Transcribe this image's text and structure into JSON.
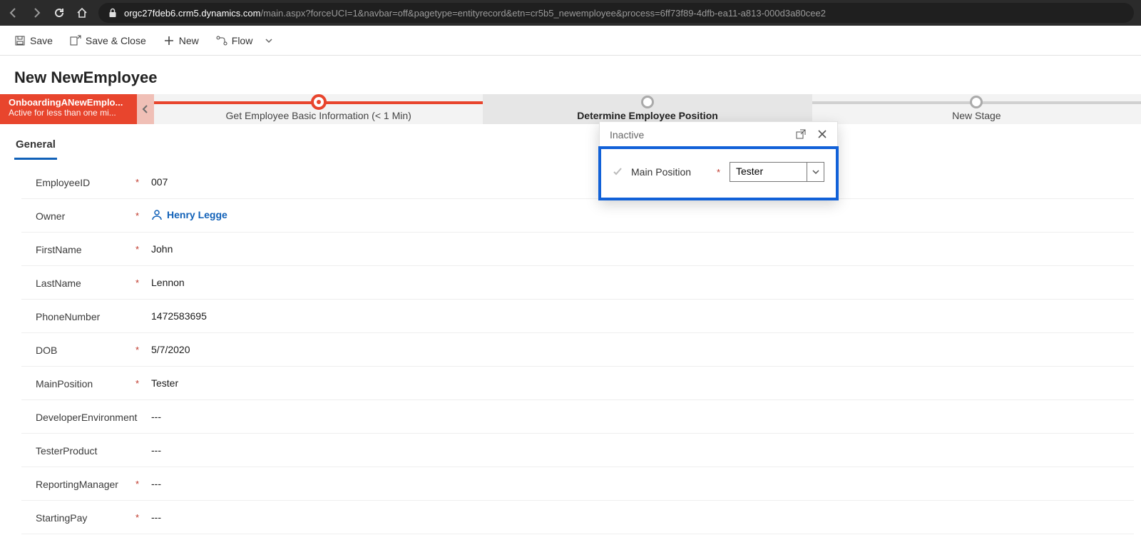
{
  "browser": {
    "url_domain": "orgc27fdeb6.crm5.dynamics.com",
    "url_path": "/main.aspx?forceUCI=1&navbar=off&pagetype=entityrecord&etn=cr5b5_newemployee&process=6ff73f89-4dfb-ea11-a813-000d3a80cee2"
  },
  "cmdbar": {
    "save": "Save",
    "save_close": "Save & Close",
    "new": "New",
    "flow": "Flow"
  },
  "page": {
    "title": "New NewEmployee"
  },
  "bpf": {
    "name": "OnboardingANewEmplo...",
    "status": "Active for less than one mi...",
    "stages": [
      {
        "label": "Get Employee Basic Information  (< 1 Min)"
      },
      {
        "label": "Determine Employee Position"
      },
      {
        "label": "New Stage"
      }
    ]
  },
  "tabs": {
    "general": "General"
  },
  "form": {
    "rows": [
      {
        "label": "EmployeeID",
        "required": true,
        "value": "007",
        "type": "text"
      },
      {
        "label": "Owner",
        "required": true,
        "value": "Henry Legge",
        "type": "owner"
      },
      {
        "label": "FirstName",
        "required": true,
        "value": "John",
        "type": "text"
      },
      {
        "label": "LastName",
        "required": true,
        "value": "Lennon",
        "type": "text"
      },
      {
        "label": "PhoneNumber",
        "required": false,
        "value": "1472583695",
        "type": "text"
      },
      {
        "label": "DOB",
        "required": true,
        "value": "5/7/2020",
        "type": "text"
      },
      {
        "label": "MainPosition",
        "required": true,
        "value": "Tester",
        "type": "text"
      },
      {
        "label": "DeveloperEnvironment",
        "required": false,
        "value": "---",
        "type": "text"
      },
      {
        "label": "TesterProduct",
        "required": false,
        "value": "---",
        "type": "text"
      },
      {
        "label": "ReportingManager",
        "required": true,
        "value": "---",
        "type": "text"
      },
      {
        "label": "StartingPay",
        "required": true,
        "value": "---",
        "type": "text"
      }
    ]
  },
  "callout": {
    "status": "Inactive",
    "field_label": "Main Position",
    "field_value": "Tester"
  }
}
